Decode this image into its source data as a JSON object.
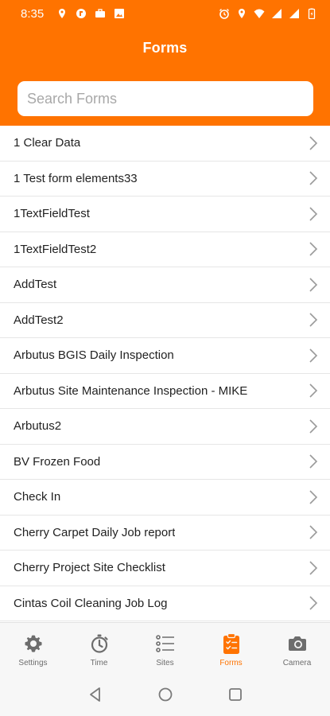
{
  "status_bar": {
    "time": "8:35"
  },
  "header": {
    "title": "Forms"
  },
  "search": {
    "placeholder": "Search Forms",
    "value": ""
  },
  "forms": [
    "1 Clear Data",
    "1 Test form elements33",
    "1TextFieldTest",
    "1TextFieldTest2",
    "AddTest",
    "AddTest2",
    "Arbutus BGIS Daily Inspection",
    "Arbutus Site Maintenance Inspection - MIKE",
    "Arbutus2",
    "BV Frozen Food",
    "Check In",
    "Cherry Carpet Daily Job report",
    "Cherry Project Site Checklist",
    "Cintas Coil Cleaning Job Log"
  ],
  "tabs": [
    {
      "label": "Settings",
      "icon": "gear-icon",
      "active": false
    },
    {
      "label": "Time",
      "icon": "stopwatch-icon",
      "active": false
    },
    {
      "label": "Sites",
      "icon": "list-icon",
      "active": false
    },
    {
      "label": "Forms",
      "icon": "clipboard-checklist-icon",
      "active": true
    },
    {
      "label": "Camera",
      "icon": "camera-icon",
      "active": false
    }
  ],
  "colors": {
    "accent": "#ff7300",
    "tab_inactive": "#6d6d6d",
    "divider": "#e6e6e6",
    "chevron": "#9a9a9a"
  }
}
